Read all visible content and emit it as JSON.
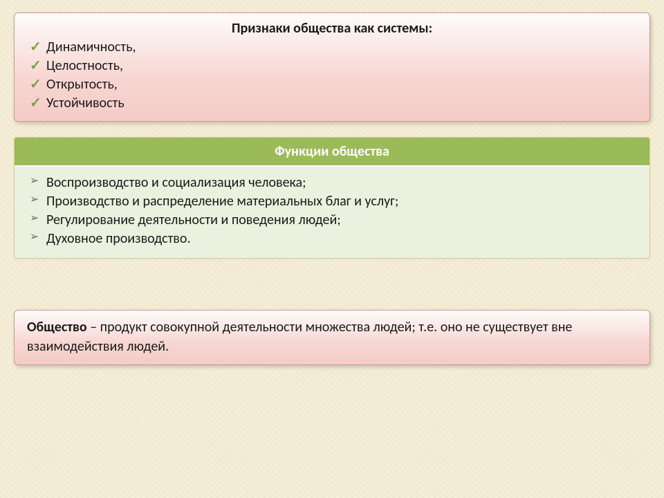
{
  "block1": {
    "title": "Признаки общества как системы:",
    "items": [
      "Динамичность,",
      "Целостность,",
      "Открытость,",
      "Устойчивость"
    ]
  },
  "block2": {
    "title": "Функции общества",
    "items": [
      "Воспроизводство и социализация человека;",
      "Производство и распределение материальных благ и услуг;",
      "Регулирование деятельности и поведения людей;",
      "Духовное производство."
    ]
  },
  "block3": {
    "term": "Общество",
    "definition": " – продукт совокупной деятельности множества людей; т.е. оно не существует вне взаимодействия людей."
  }
}
